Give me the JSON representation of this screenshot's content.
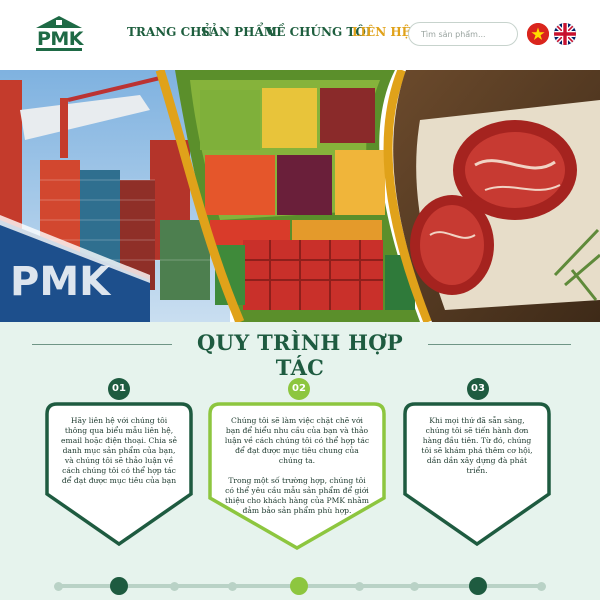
{
  "header": {
    "logo_text": "PMK",
    "nav": [
      {
        "label": "TRANG CHỦ",
        "active": false
      },
      {
        "label": "SẢN PHẨM",
        "active": false
      },
      {
        "label": "VỀ CHÚNG TÔI",
        "active": false
      },
      {
        "label": "LIÊN HỆ",
        "active": true
      }
    ],
    "search_placeholder": "Tìm sản phẩm...",
    "languages": [
      {
        "code": "vi",
        "icon": "vietnam-flag-icon"
      },
      {
        "code": "en",
        "icon": "uk-flag-icon"
      }
    ]
  },
  "hero": {
    "panels": [
      "container-port-photo",
      "fruit-market-photo",
      "beef-steak-photo"
    ]
  },
  "process": {
    "title": "QUY TRÌNH HỢP TÁC",
    "steps": [
      {
        "number": "01",
        "paragraphs": [
          "Hãy liên hệ với chúng tôi thông qua biểu mẫu liên hệ, email hoặc điện thoại. Chia sẻ danh mục sản phẩm của bạn, và chúng tôi sẽ thảo luận về cách chúng tôi có thể hợp tác để đạt được mục tiêu của bạn"
        ],
        "color": "#1e5b40"
      },
      {
        "number": "02",
        "paragraphs": [
          "Chúng tôi sẽ làm việc chặt chẽ với bạn để hiểu nhu cầu của bạn và thảo luận về cách chúng tôi có thể hợp tác để đạt được mục tiêu chung của chúng ta.",
          "Trong một số trường hợp, chúng tôi có thể yêu cầu mẫu sản phẩm để giới thiệu cho khách hàng của PMK nhằm đảm bảo sản phẩm phù hợp."
        ],
        "color": "#8dc63f"
      },
      {
        "number": "03",
        "paragraphs": [
          "Khi mọi thứ đã sẵn sàng, chúng tôi sẽ tiến hành đơn hàng đầu tiên. Từ đó, chúng tôi sẽ khám phá thêm cơ hội, dần dần xây dựng đà phát triển."
        ],
        "color": "#1e5b40"
      }
    ]
  },
  "colors": {
    "brand_green": "#1e5b40",
    "accent_lime": "#8dc63f",
    "active_nav": "#e0a21a",
    "section_bg": "#e6f3ed"
  }
}
